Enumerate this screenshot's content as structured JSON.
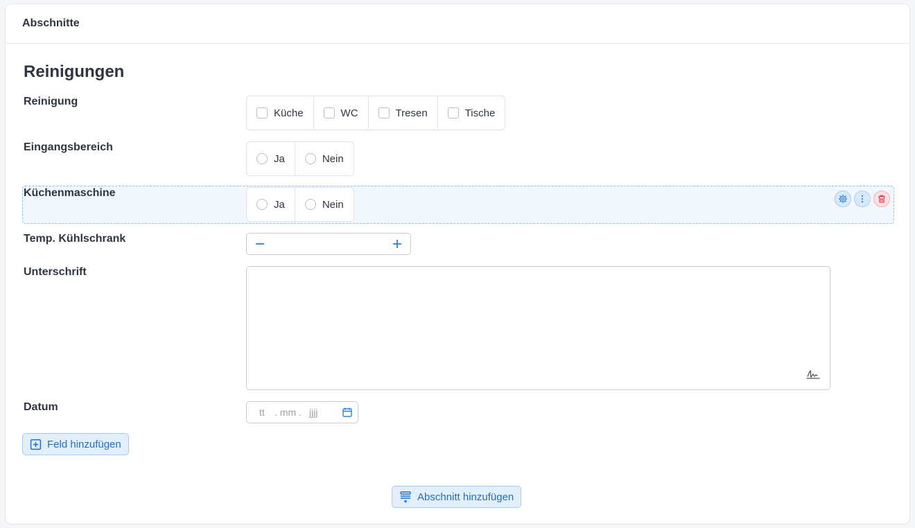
{
  "header": {
    "title": "Abschnitte"
  },
  "section": {
    "title": "Reinigungen"
  },
  "fields": {
    "reinigung": {
      "label": "Reinigung",
      "options": [
        "Küche",
        "WC",
        "Tresen",
        "Tische"
      ]
    },
    "eingangsbereich": {
      "label": "Eingangsbereich",
      "options": [
        "Ja",
        "Nein"
      ]
    },
    "kuechenmaschine": {
      "label": "Küchenmaschine",
      "options": [
        "Ja",
        "Nein"
      ]
    },
    "temp": {
      "label": "Temp. Kühlschrank"
    },
    "unterschrift": {
      "label": "Unterschrift"
    },
    "datum": {
      "label": "Datum",
      "day_placeholder": "tt",
      "month_placeholder": "mm",
      "year_placeholder": "jjjj"
    }
  },
  "buttons": {
    "add_field": "Feld hinzufügen",
    "add_section": "Abschnitt hinzufügen"
  },
  "icons": {
    "settings": "gear-icon",
    "more": "kebab-icon",
    "delete": "trash-icon",
    "minus": "minus-icon",
    "plus": "plus-icon",
    "signature": "signature-icon",
    "calendar": "calendar-icon",
    "add_field": "plus-square-icon",
    "add_section": "add-section-icon"
  },
  "colors": {
    "accent": "#2d80d9",
    "danger": "#d9394a",
    "highlight_bg": "#f1f7fd"
  }
}
